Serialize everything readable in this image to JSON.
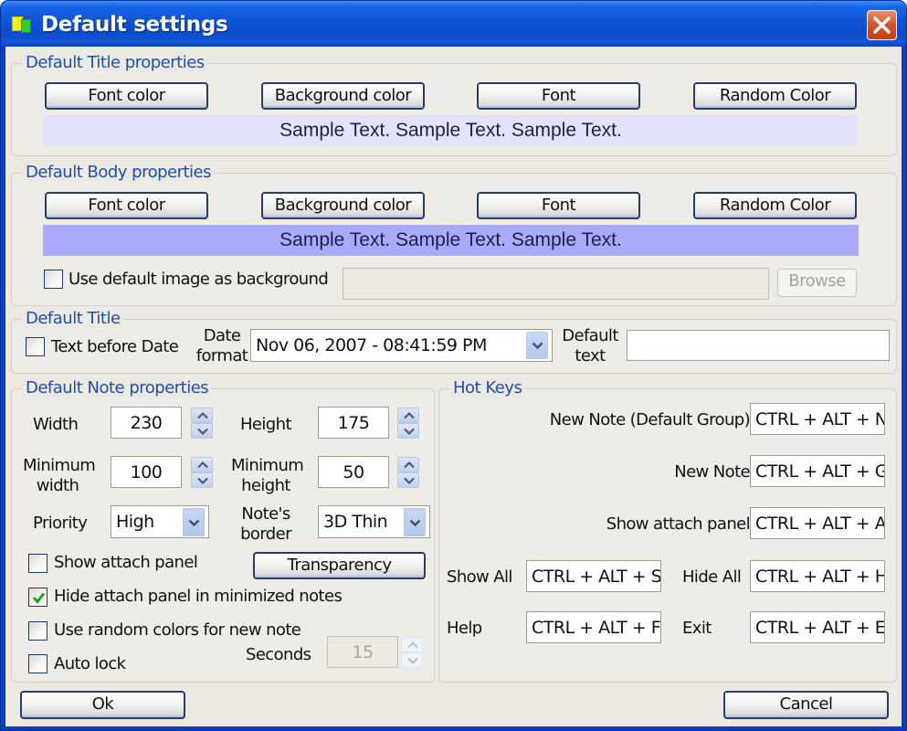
{
  "window": {
    "title": "Default settings",
    "icon": "app-notes-icon",
    "close_icon": "close-icon"
  },
  "title_props": {
    "label": "Default Title properties",
    "buttons": [
      "Font color",
      "Background color",
      "Font",
      "Random Color"
    ],
    "sample_text": "Sample Text. Sample Text. Sample Text.",
    "sample_bg": "#e4e3fd"
  },
  "body_props": {
    "label": "Default Body properties",
    "buttons": [
      "Font color",
      "Background color",
      "Font",
      "Random Color"
    ],
    "sample_text": "Sample Text. Sample Text. Sample Text.",
    "sample_bg": "#aaaafd",
    "use_image_label": "Use default image as background",
    "use_image_checked": false,
    "image_path": "",
    "browse_label": "Browse"
  },
  "default_title": {
    "label": "Default Title",
    "text_before_date_label": "Text before Date",
    "text_before_date_checked": false,
    "date_format_label_1": "Date",
    "date_format_label_2": "format",
    "date_format_value": "Nov 06, 2007 - 08:41:59 PM",
    "default_text_label_1": "Default",
    "default_text_label_2": "text",
    "default_text_value": ""
  },
  "note_props": {
    "label": "Default Note properties",
    "width_label": "Width",
    "width_value": "230",
    "height_label": "Height",
    "height_value": "175",
    "min_width_label_1": "Minimum",
    "min_width_label_2": "width",
    "min_width_value": "100",
    "min_height_label_1": "Minimum",
    "min_height_label_2": "height",
    "min_height_value": "50",
    "priority_label": "Priority",
    "priority_value": "High",
    "border_label_1": "Note's",
    "border_label_2": "border",
    "border_value": "3D Thin",
    "show_attach_label": "Show attach panel",
    "show_attach_checked": false,
    "transparency_label": "Transparency",
    "hide_attach_label": "Hide attach panel in minimized notes",
    "hide_attach_checked": true,
    "random_colors_label": "Use random colors for new note",
    "random_colors_checked": false,
    "auto_lock_label": "Auto lock",
    "auto_lock_checked": false,
    "seconds_label": "Seconds",
    "seconds_value": "15"
  },
  "hot_keys": {
    "label": "Hot Keys",
    "new_note_default_label": "New Note (Default Group)",
    "new_note_default_value": "CTRL + ALT + N",
    "new_note_label": "New Note",
    "new_note_value": "CTRL + ALT + G",
    "show_attach_label": "Show attach panel",
    "show_attach_value": "CTRL + ALT + A",
    "show_all_label": "Show All",
    "show_all_value": "CTRL + ALT + S",
    "hide_all_label": "Hide All",
    "hide_all_value": "CTRL + ALT + H",
    "help_label": "Help",
    "help_value": "CTRL + ALT + F",
    "exit_label": "Exit",
    "exit_value": "CTRL + ALT + E"
  },
  "footer": {
    "ok_label": "Ok",
    "cancel_label": "Cancel"
  },
  "colors": {
    "titlebar": "#0b4ccd",
    "group_label": "#1f4fa8",
    "check_mark": "#21a121",
    "close_button": "#d4532a"
  }
}
